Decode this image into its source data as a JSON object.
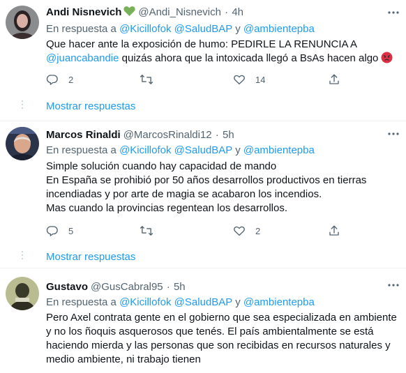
{
  "colors": {
    "accent": "#1d9bf0",
    "secondary_text": "#536471",
    "divider": "#eff3f4",
    "verified_heart": "#78b159"
  },
  "tweets": [
    {
      "name": "Andi Nisnevich",
      "has_green_heart": true,
      "handle": "@Andi_Nisnevich",
      "separator": "·",
      "time": "4h",
      "reply_prefix": "En respuesta a",
      "reply_mentions": [
        "@Kicillofok",
        "@SaludBAP"
      ],
      "reply_conj": "y",
      "reply_last": "@ambientepba",
      "text_line1": "Que hacer ante la exposición de humo: PEDIRLE LA RENUNCIA A",
      "text_mention": "@juancabandie",
      "text_line2_rest": " quizás ahora que la intoxicada llegó a BsAs hacen algo",
      "emoji": "angry-face",
      "replies": "2",
      "retweets": "",
      "likes": "14",
      "show_more": "Mostrar respuestas"
    },
    {
      "name": "Marcos Rinaldi",
      "handle": "@MarcosRinaldi12",
      "separator": "·",
      "time": "5h",
      "reply_prefix": "En respuesta a",
      "reply_mentions": [
        "@Kicillofok",
        "@SaludBAP"
      ],
      "reply_conj": "y",
      "reply_last": "@ambientepba",
      "lines": [
        "Simple solución cuando hay capacidad de mando",
        "En España se prohibió por 50 años desarrollos productivos en tierras",
        "incendiadas y por arte de magia se acabaron los incendios.",
        "Mas cuando la provincias regentean los desarrollos."
      ],
      "replies": "5",
      "retweets": "",
      "likes": "2",
      "show_more": "Mostrar respuestas"
    },
    {
      "name": "Gustavo",
      "handle": "@GusCabral95",
      "separator": "·",
      "time": "5h",
      "reply_prefix": "En respuesta a",
      "reply_mentions": [
        "@Kicillofok",
        "@SaludBAP"
      ],
      "reply_conj": "y",
      "reply_last": "@ambientepba",
      "lines": [
        "Pero Axel contrata gente en el gobierno que sea especializada en ambiente",
        "y no los ñoquis asquerosos que tenés. El país ambientalmente se está",
        "haciendo mierda y las personas que son recibidas en recursos naturales y",
        "medio ambiente, ni trabajo tienen"
      ]
    }
  ],
  "icons": {
    "reply": "reply-icon",
    "retweet": "retweet-icon",
    "like": "heart-icon",
    "share": "share-icon",
    "more": "more-icon"
  }
}
